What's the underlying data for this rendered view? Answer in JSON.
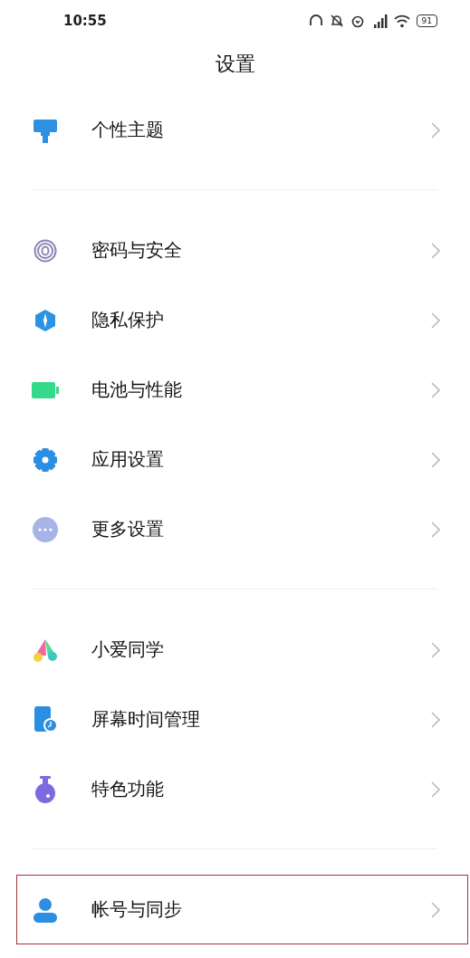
{
  "status_bar": {
    "time": "10:55",
    "battery": "91"
  },
  "title": "设置",
  "sections": [
    {
      "items": [
        {
          "label": "个性主题",
          "highlighted": false
        }
      ]
    },
    {
      "items": [
        {
          "label": "密码与安全",
          "highlighted": false
        },
        {
          "label": "隐私保护",
          "highlighted": false
        },
        {
          "label": "电池与性能",
          "highlighted": false
        },
        {
          "label": "应用设置",
          "highlighted": false
        },
        {
          "label": "更多设置",
          "highlighted": false
        }
      ]
    },
    {
      "items": [
        {
          "label": "小爱同学",
          "highlighted": false
        },
        {
          "label": "屏幕时间管理",
          "highlighted": false
        },
        {
          "label": "特色功能",
          "highlighted": false
        }
      ]
    },
    {
      "items": [
        {
          "label": "帐号与同步",
          "highlighted": true
        }
      ]
    }
  ]
}
